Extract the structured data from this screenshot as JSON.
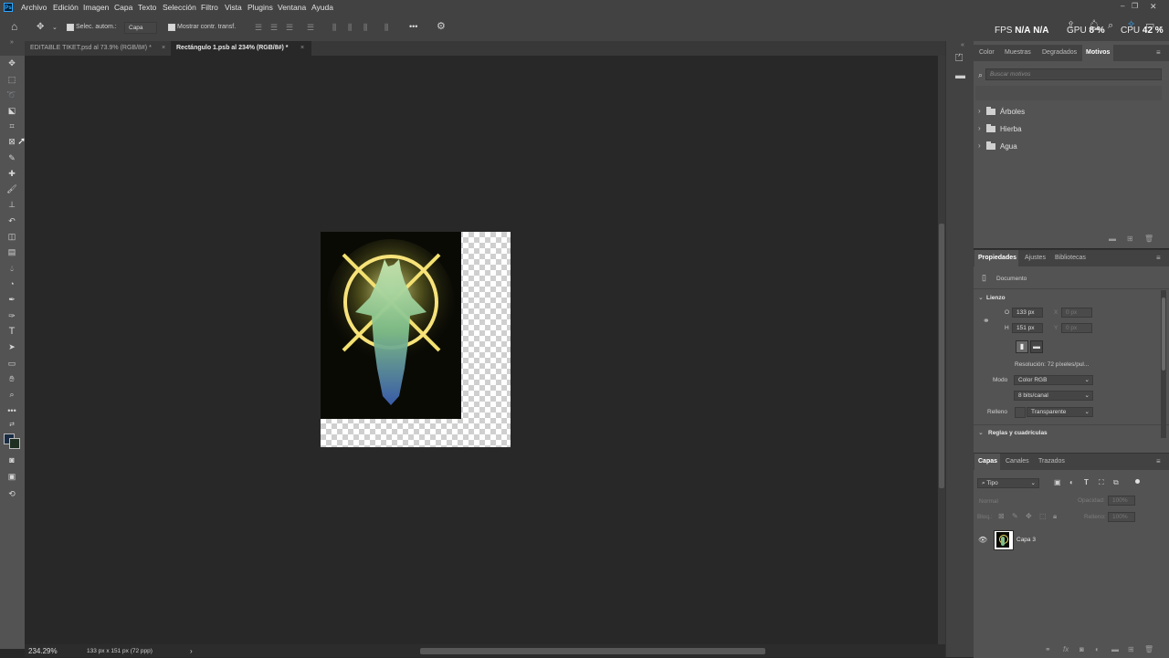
{
  "app": {
    "logo_text": "Ps"
  },
  "menu": [
    "Archivo",
    "Edición",
    "Imagen",
    "Capa",
    "Texto",
    "Selección",
    "Filtro",
    "Vista",
    "Plugins",
    "Ventana",
    "Ayuda"
  ],
  "options_bar": {
    "auto_select_label": "Selec. autom.:",
    "auto_select_value": "Capa",
    "show_transform_label": "Mostrar contr. transf.",
    "more_label": "•••"
  },
  "performance": {
    "fps_label": "FPS",
    "fps_value": "N/A",
    "fps_value2": "N/A",
    "gpu_label": "GPU",
    "gpu_value": "8 %",
    "cpu_label": "CPU",
    "cpu_value": "42 %"
  },
  "tabs": [
    {
      "label": "EDITABLE TIKET.psd al 73.9% (RGB/8#) *",
      "close": "×"
    },
    {
      "label": "Rectángulo 1.psb al 234% (RGB/8#) *",
      "close": "×"
    }
  ],
  "status": {
    "zoom": "234.29%",
    "doc_info": "133 px x 151 px (72 ppp)",
    "arrow": "›"
  },
  "patterns_panel": {
    "tabs": [
      "Color",
      "Muestras",
      "Degradados",
      "Motivos"
    ],
    "active_tab": "Motivos",
    "search_placeholder": "Buscar motivos",
    "folders": [
      "Árboles",
      "Hierba",
      "Agua"
    ]
  },
  "properties_panel": {
    "tabs": [
      "Propiedades",
      "Ajustes",
      "Bibliotecas"
    ],
    "doc_label": "Documento",
    "section_canvas": "Lienzo",
    "w_label": "O",
    "w_value": "133 px",
    "h_label": "H",
    "h_value": "151 px",
    "x_label": "X",
    "x_value": "0 px",
    "y_label": "Y",
    "y_value": "0 px",
    "resolution": "Resolución: 72 píxeles/pul...",
    "mode_label": "Modo",
    "mode_value": "Color RGB",
    "bits_value": "8 bits/canal",
    "fill_label": "Relleno",
    "fill_value": "Transparente",
    "section_rulers": "Reglas y cuadrículas"
  },
  "layers_panel": {
    "tabs": [
      "Capas",
      "Canales",
      "Trazados"
    ],
    "filter_value": "Tipo",
    "blend_mode": "Normal",
    "opacity_label": "Opacidad:",
    "opacity_value": "100%",
    "lock_label": "Bloq.:",
    "fill_label": "Relleno:",
    "fill_value": "100%",
    "layers": [
      {
        "name": "Capa 3",
        "visible": true
      }
    ]
  },
  "colors": {
    "accent": "#31a8ff",
    "menubar": "#424242",
    "canvas_bg": "#282828",
    "panel_bg": "#535353"
  }
}
